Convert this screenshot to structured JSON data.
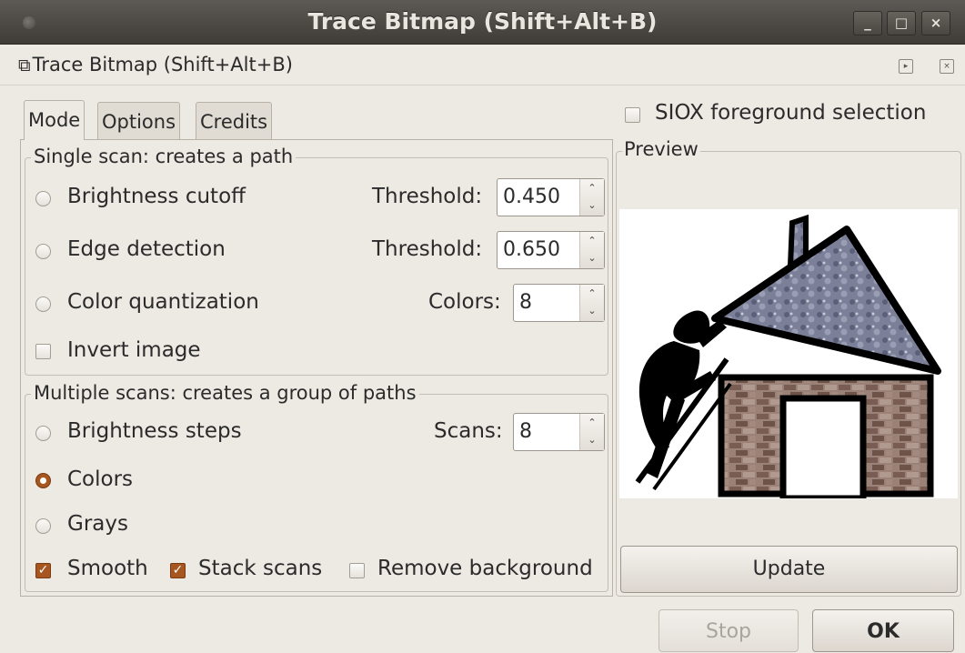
{
  "window": {
    "title": "Trace Bitmap (Shift+Alt+B)",
    "min_glyph": "_",
    "max_glyph": "□",
    "close_glyph": "×"
  },
  "dock": {
    "title": "Trace Bitmap (Shift+Alt+B)",
    "icon_glyph": "⧉",
    "btn_a_glyph": "▸",
    "btn_b_glyph": "×"
  },
  "tabs": [
    {
      "label": "Mode",
      "active": true
    },
    {
      "label": "Options",
      "active": false
    },
    {
      "label": "Credits",
      "active": false
    }
  ],
  "single_scan": {
    "legend": "Single scan: creates a path",
    "brightness": {
      "label": "Brightness cutoff",
      "field_label": "Threshold:",
      "value": "0.450",
      "selected": false
    },
    "edge": {
      "label": "Edge detection",
      "field_label": "Threshold:",
      "value": "0.650",
      "selected": false
    },
    "quant": {
      "label": "Color quantization",
      "field_label": "Colors:",
      "value": "8",
      "selected": false
    },
    "invert": {
      "label": "Invert image",
      "checked": false
    }
  },
  "multi_scan": {
    "legend": "Multiple scans: creates a group of paths",
    "steps": {
      "label": "Brightness steps",
      "field_label": "Scans:",
      "value": "8",
      "selected": false
    },
    "colors": {
      "label": "Colors",
      "selected": true
    },
    "grays": {
      "label": "Grays",
      "selected": false
    },
    "smooth": {
      "label": "Smooth",
      "checked": true
    },
    "stack": {
      "label": "Stack scans",
      "checked": true
    },
    "remove_bg": {
      "label": "Remove background",
      "checked": false
    }
  },
  "siox": {
    "label": "SIOX foreground selection",
    "checked": false
  },
  "preview": {
    "legend": "Preview"
  },
  "buttons": {
    "update": "Update",
    "stop": "Stop",
    "ok": "OK"
  },
  "spin_glyphs": {
    "up": "⌃",
    "down": "⌄"
  },
  "check_glyph": "✓",
  "colors": {
    "accent": "#a8561f",
    "titlebar": "#4a4641",
    "background": "#ede9e3"
  }
}
